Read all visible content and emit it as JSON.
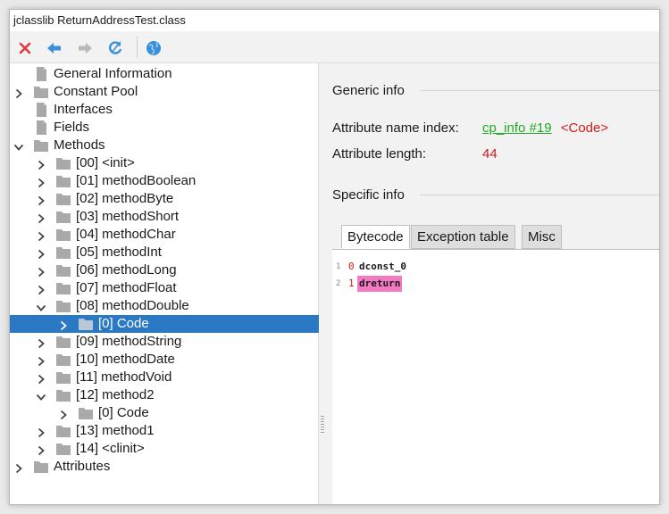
{
  "window": {
    "title": "jclasslib ReturnAddressTest.class"
  },
  "toolbar": {
    "buttons": [
      {
        "name": "close",
        "icon": "close-x-icon",
        "color": "#e0393e"
      },
      {
        "name": "back",
        "icon": "arrow-left-icon",
        "color": "#3a8fd8"
      },
      {
        "name": "forward",
        "icon": "arrow-right-icon",
        "color": "#b8b8b8"
      },
      {
        "name": "reload",
        "icon": "refresh-icon",
        "color": "#3a8fd8"
      },
      {
        "name": "browser",
        "icon": "globe-icon",
        "color": "#3a8fd8"
      }
    ]
  },
  "tree": {
    "selected_color": "#2a79c4",
    "rows": [
      {
        "label": "General Information",
        "level": 0,
        "arrow": "none",
        "icon": "file"
      },
      {
        "label": "Constant Pool",
        "level": 0,
        "arrow": "right",
        "icon": "folder"
      },
      {
        "label": "Interfaces",
        "level": 0,
        "arrow": "none",
        "icon": "file"
      },
      {
        "label": "Fields",
        "level": 0,
        "arrow": "none",
        "icon": "file"
      },
      {
        "label": "Methods",
        "level": 0,
        "arrow": "down",
        "icon": "folder"
      },
      {
        "label": "[00] <init>",
        "level": 1,
        "arrow": "right",
        "icon": "folder"
      },
      {
        "label": "[01] methodBoolean",
        "level": 1,
        "arrow": "right",
        "icon": "folder"
      },
      {
        "label": "[02] methodByte",
        "level": 1,
        "arrow": "right",
        "icon": "folder"
      },
      {
        "label": "[03] methodShort",
        "level": 1,
        "arrow": "right",
        "icon": "folder"
      },
      {
        "label": "[04] methodChar",
        "level": 1,
        "arrow": "right",
        "icon": "folder"
      },
      {
        "label": "[05] methodInt",
        "level": 1,
        "arrow": "right",
        "icon": "folder"
      },
      {
        "label": "[06] methodLong",
        "level": 1,
        "arrow": "right",
        "icon": "folder"
      },
      {
        "label": "[07] methodFloat",
        "level": 1,
        "arrow": "right",
        "icon": "folder"
      },
      {
        "label": "[08] methodDouble",
        "level": 1,
        "arrow": "down",
        "icon": "folder"
      },
      {
        "label": "[0] Code",
        "level": 2,
        "arrow": "right",
        "icon": "folder",
        "selected": true
      },
      {
        "label": "[09] methodString",
        "level": 1,
        "arrow": "right",
        "icon": "folder"
      },
      {
        "label": "[10] methodDate",
        "level": 1,
        "arrow": "right",
        "icon": "folder"
      },
      {
        "label": "[11] methodVoid",
        "level": 1,
        "arrow": "right",
        "icon": "folder"
      },
      {
        "label": "[12] method2",
        "level": 1,
        "arrow": "down",
        "icon": "folder"
      },
      {
        "label": "[0] Code",
        "level": 2,
        "arrow": "right",
        "icon": "folder"
      },
      {
        "label": "[13] method1",
        "level": 1,
        "arrow": "right",
        "icon": "folder"
      },
      {
        "label": "[14] <clinit>",
        "level": 1,
        "arrow": "right",
        "icon": "folder"
      },
      {
        "label": "Attributes",
        "level": 0,
        "arrow": "right",
        "icon": "folder"
      }
    ]
  },
  "detail": {
    "generic_title": "Generic info",
    "name_index_label": "Attribute name index:",
    "name_index_link": "cp_info #19",
    "name_index_value": "<Code>",
    "length_label": "Attribute length:",
    "length_value": "44",
    "specific_title": "Specific info",
    "tabs": [
      {
        "label": "Bytecode",
        "active": true
      },
      {
        "label": "Exception table",
        "active": false
      },
      {
        "label": "Misc",
        "active": false
      }
    ],
    "code": [
      {
        "line": "1",
        "offset": "0",
        "instruction": "dconst_0",
        "highlight": false
      },
      {
        "line": "2",
        "offset": "1",
        "instruction": "dreturn",
        "highlight": true
      }
    ],
    "highlight_color": "#f37ac2",
    "link_color": "#1faa1f",
    "value_color": "#d11b1b"
  }
}
